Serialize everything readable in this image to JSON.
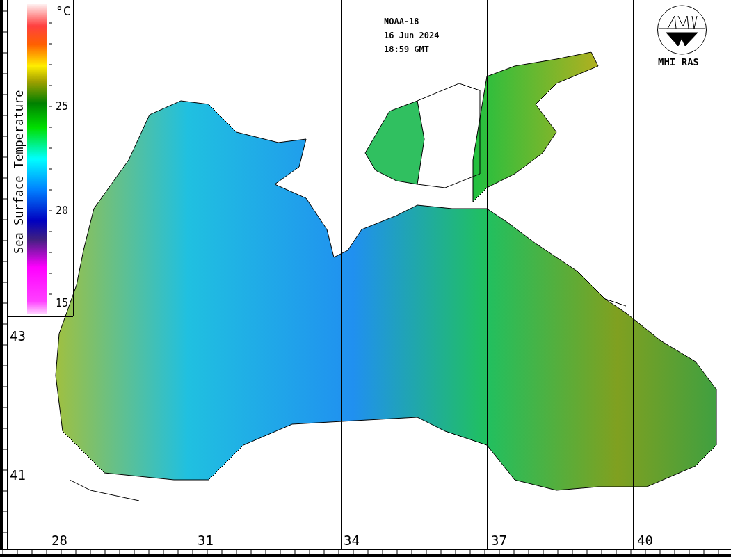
{
  "header": {
    "satellite": "NOAA-18",
    "date": "16 Jun 2024",
    "time": "18:59 GMT"
  },
  "logo": {
    "label": "MHI RAS"
  },
  "legend": {
    "title": "Sea Surface Temperature",
    "unit": "°C",
    "ticks": [
      "25",
      "20",
      "15"
    ]
  },
  "latitude_labels": [
    "43",
    "41"
  ],
  "longitude_labels": [
    "28",
    "31",
    "34",
    "37",
    "40"
  ]
}
